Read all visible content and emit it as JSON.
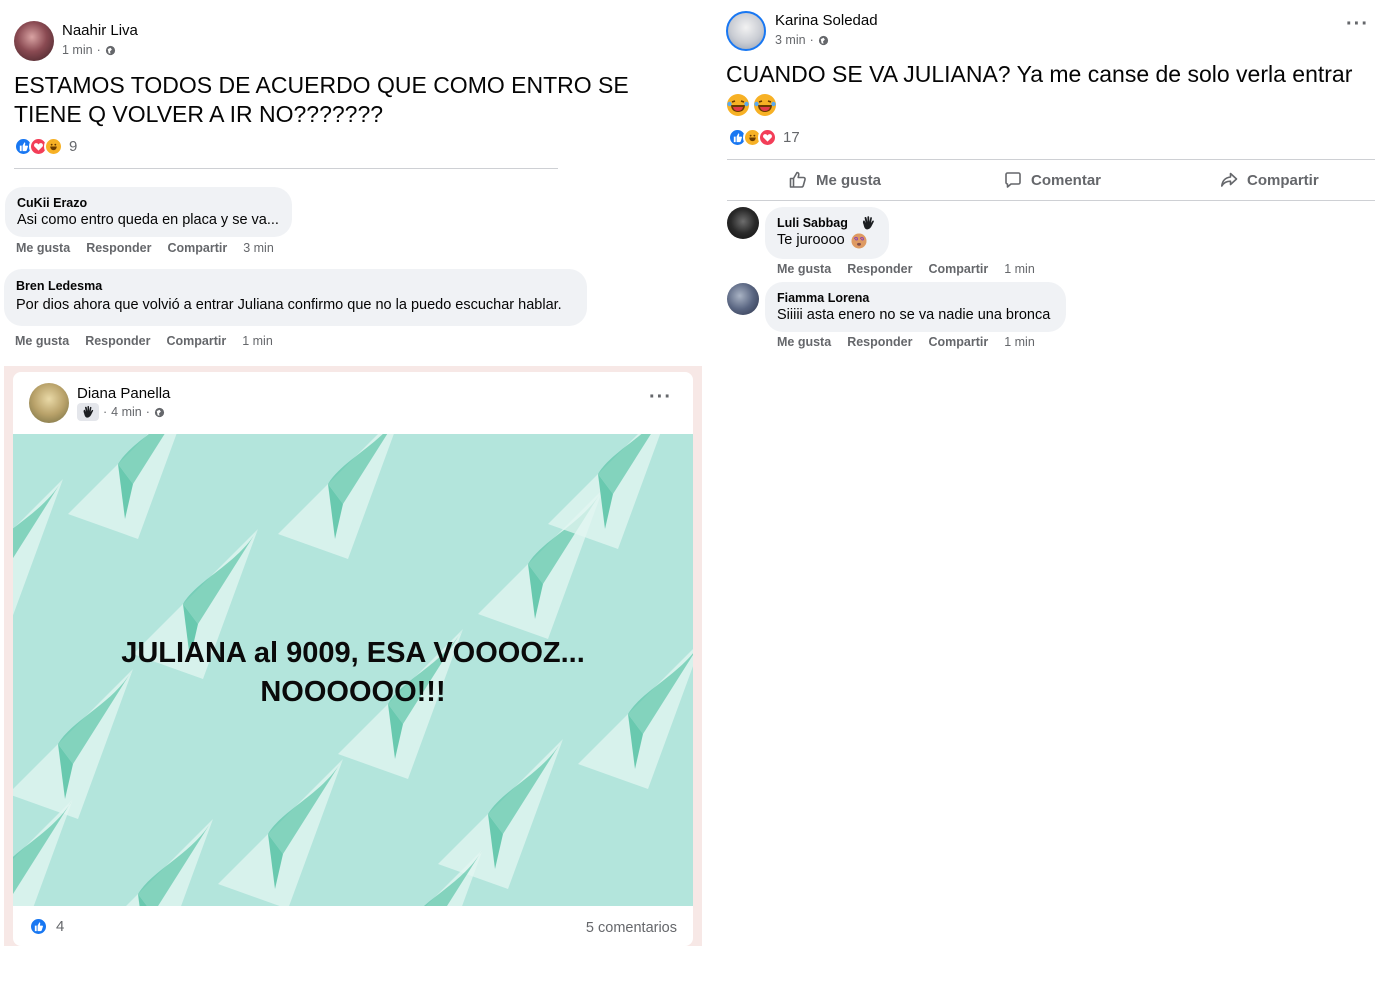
{
  "post1": {
    "author": "Naahir Liva",
    "time": "1 min",
    "text": "ESTAMOS TODOS DE ACUERDO QUE COMO ENTRO SE TIENE Q VOLVER A IR NO???????",
    "reaction_count": "9",
    "comments": [
      {
        "author": "CuKii Erazo",
        "text": "Asi como entro queda en placa y se va...",
        "like": "Me gusta",
        "reply": "Responder",
        "share": "Compartir",
        "time": "3 min"
      },
      {
        "author": "Bren Ledesma",
        "text": "Por dios ahora que volvió a entrar Juliana confirmo que no la puedo escuchar hablar.",
        "like": "Me gusta",
        "reply": "Responder",
        "share": "Compartir",
        "time": "1 min"
      }
    ]
  },
  "post2": {
    "author": "Karina Soledad",
    "time": "3 min",
    "text": "CUANDO SE VA JULIANA? Ya me canse de solo verla entrar",
    "reaction_count": "17",
    "actions": {
      "like": "Me gusta",
      "comment": "Comentar",
      "share": "Compartir"
    },
    "comments": [
      {
        "author": "Luli Sabbag",
        "text": "Te juroooo",
        "like": "Me gusta",
        "reply": "Responder",
        "share": "Compartir",
        "time": "1 min"
      },
      {
        "author": "Fiamma Lorena",
        "text": "Siiiii asta enero no se va nadie una bronca",
        "like": "Me gusta",
        "reply": "Responder",
        "share": "Compartir",
        "time": "1 min"
      }
    ]
  },
  "post3": {
    "author": "Diana Panella",
    "time": "4 min",
    "image_text_line1": "JULIANA al 9009, ESA VOOOOZ...",
    "image_text_line2": "NOOOOOO!!!",
    "reaction_count": "4",
    "comments_count": "5 comentarios"
  },
  "colors": {
    "accent": "#1877f2",
    "love": "#f33e58",
    "haha": "#f7b125",
    "image_bg": "#b3e5dc",
    "plane": "#e3f5f1",
    "plane_shade": "#56c2a4"
  }
}
